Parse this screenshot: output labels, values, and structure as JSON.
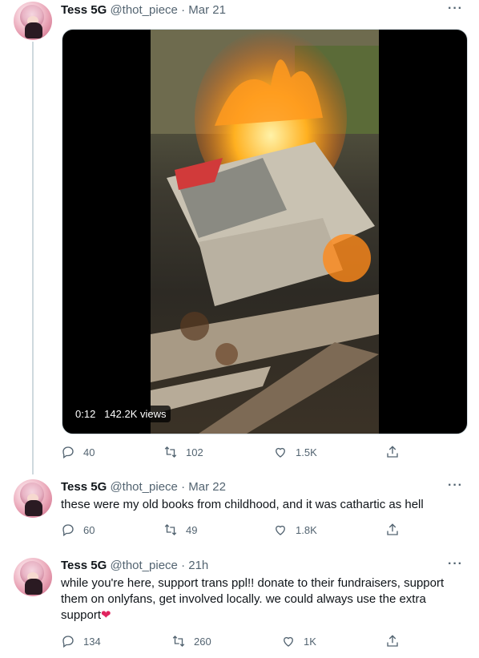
{
  "tweets": [
    {
      "name": "Tess 5G",
      "handle": "@thot_piece",
      "sep": "·",
      "date": "Mar 21",
      "more": "···",
      "media": {
        "duration": "0:12",
        "views": "142.2K views"
      },
      "replies": "40",
      "retweets": "102",
      "likes": "1.5K"
    },
    {
      "name": "Tess 5G",
      "handle": "@thot_piece",
      "sep": "·",
      "date": "Mar 22",
      "more": "···",
      "text": "these were my old books from childhood, and it was cathartic as hell",
      "replies": "60",
      "retweets": "49",
      "likes": "1.8K"
    },
    {
      "name": "Tess 5G",
      "handle": "@thot_piece",
      "sep": "·",
      "date": "21h",
      "more": "···",
      "text": "while you're here, support trans ppl!! donate to their fundraisers, support them on onlyfans, get involved locally. we could always use the extra support",
      "emoji": "❤",
      "replies": "134",
      "retweets": "260",
      "likes": "1K"
    }
  ],
  "icons": [
    "reply-icon",
    "retweet-icon",
    "like-icon",
    "share-icon"
  ],
  "colors": {
    "muted": "#536471",
    "heart": "#e0245e",
    "thread_line": "#cfd9de"
  }
}
